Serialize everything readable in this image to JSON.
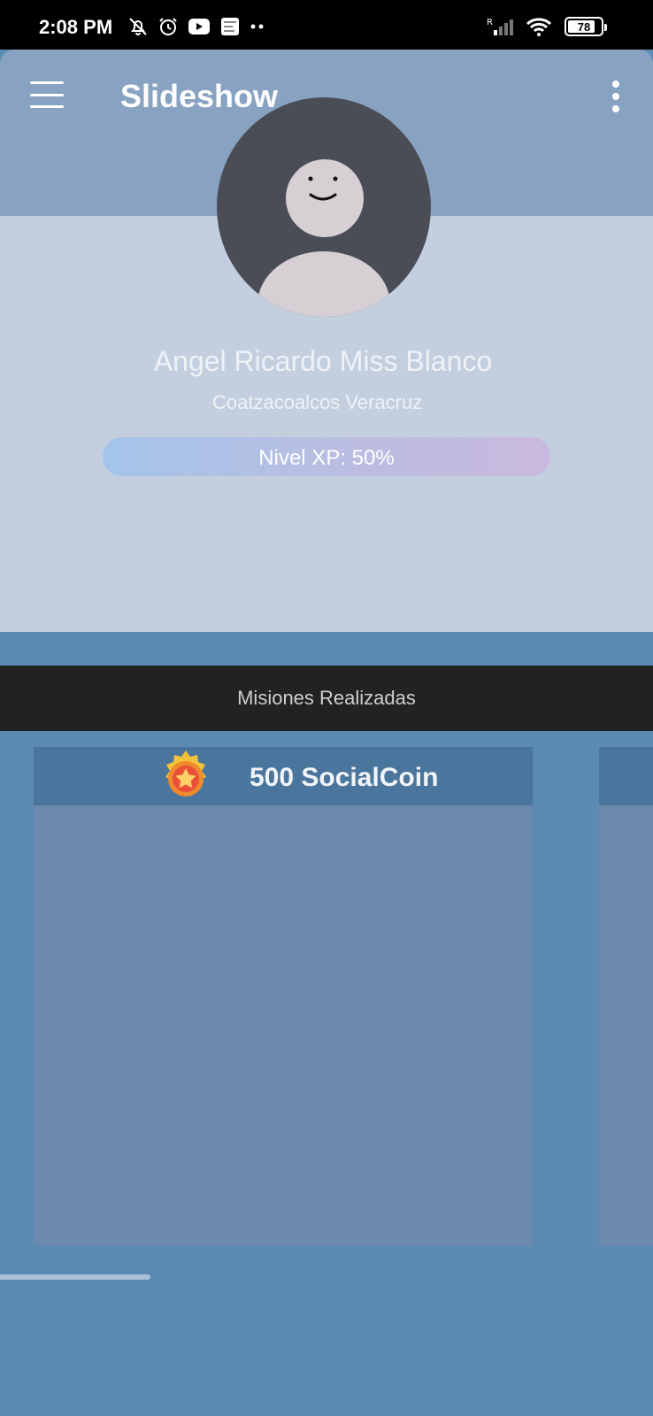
{
  "status_bar": {
    "time": "2:08 PM",
    "battery": "78",
    "network": "R"
  },
  "app_bar": {
    "title": "Slideshow"
  },
  "profile": {
    "name": "Angel Ricardo Miss Blanco",
    "location": "Coatzacoalcos Veracruz",
    "xp_label": "Nivel XP: 50%",
    "xp_fraction": 0.5
  },
  "section": {
    "title": "Misiones Realizadas"
  },
  "cards": [
    {
      "reward": "500 SocialCoin",
      "icon": "medal-star-icon"
    }
  ],
  "colors": {
    "app_bar": "#88a2c2",
    "profile_bg": "#c3cfdf",
    "page_bg": "#5b8bb3",
    "section_bg": "#222222",
    "card_bg": "#6b8aad",
    "card_header": "#4a759d"
  }
}
